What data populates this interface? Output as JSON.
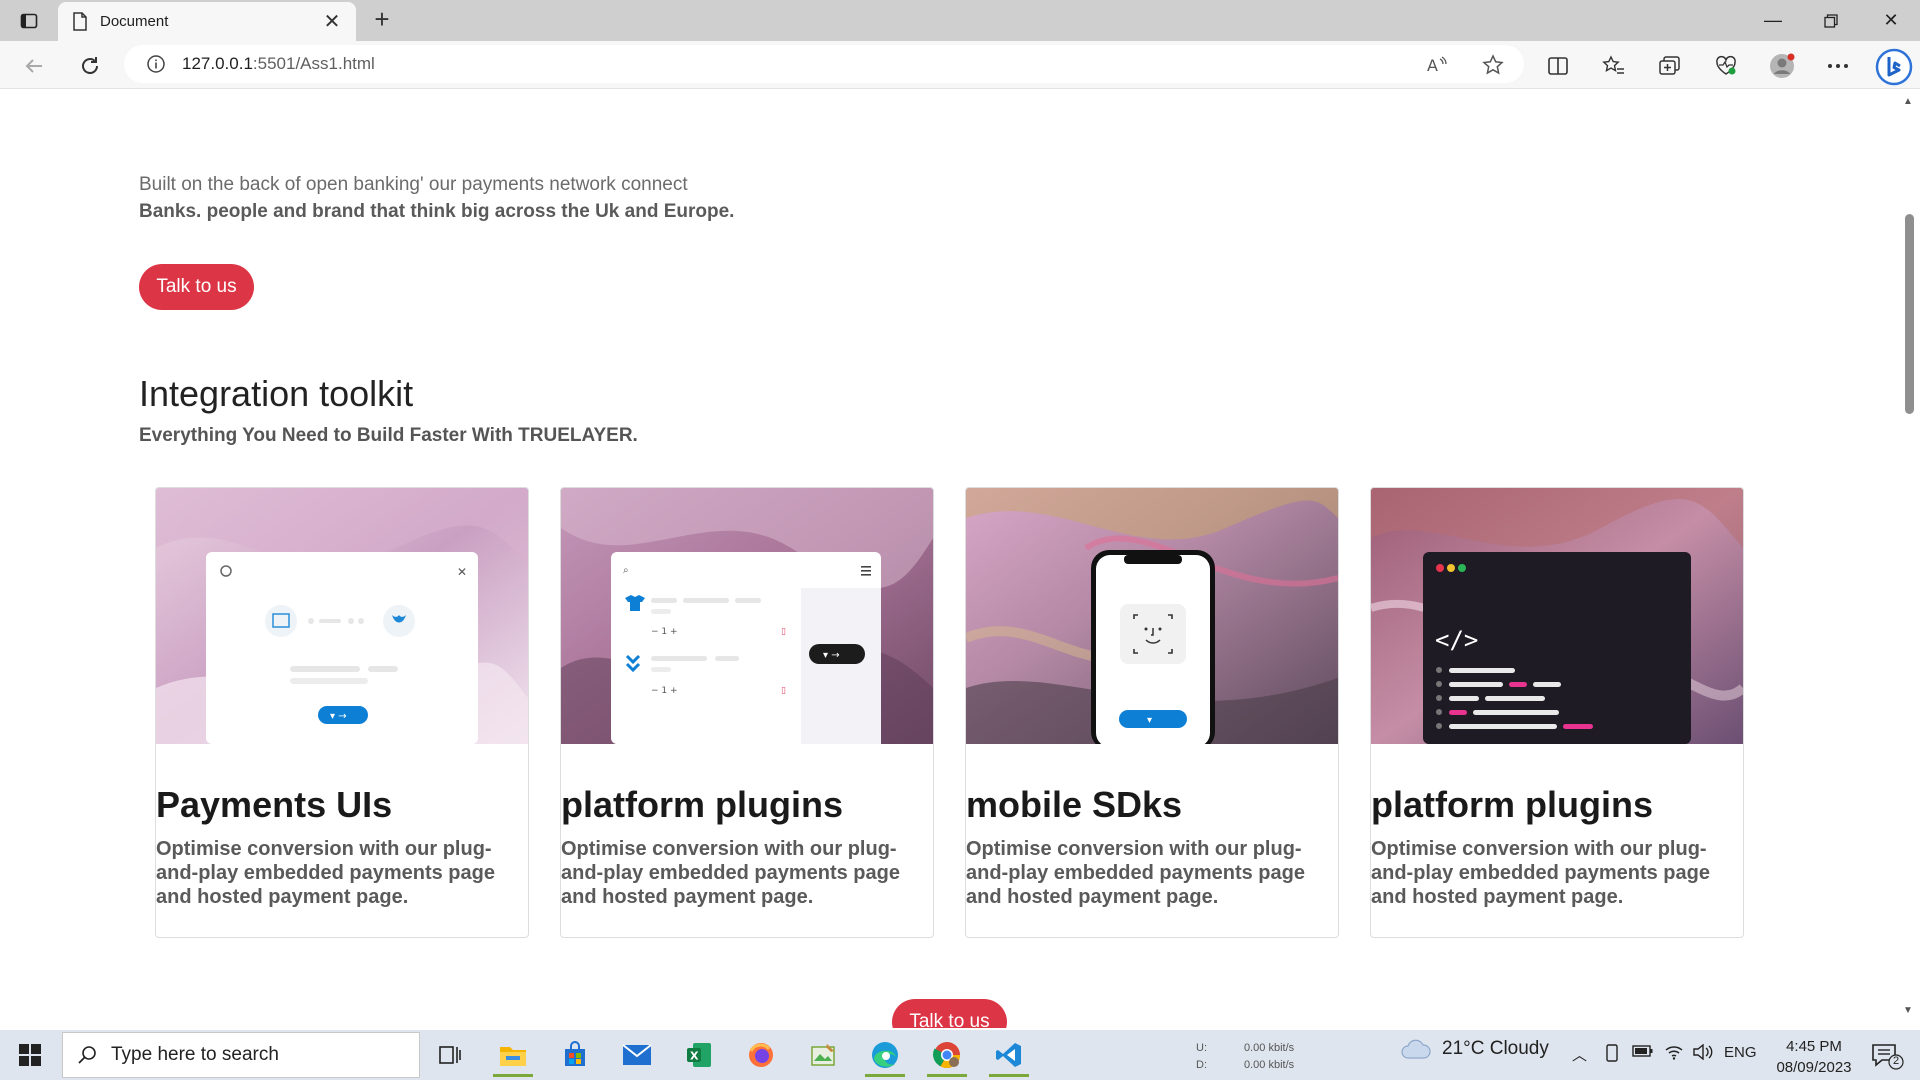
{
  "browser": {
    "tab_title": "Document",
    "url_host": "127.0.0.1",
    "url_rest": ":5501/Ass1.html"
  },
  "page": {
    "intro_line1": "Built on the back of open banking' our payments network connect",
    "intro_line2": "Banks. people and brand that think big across the Uk and Europe.",
    "cta_label": "Talk to us",
    "section_title": "Integration toolkit",
    "section_subtitle": "Everything You Need to Build Faster With TRUELAYER.",
    "cards": [
      {
        "title": "Payments UIs",
        "text": "Optimise conversion with our plug-and-play embedded payments page and hosted payment page."
      },
      {
        "title": "platform plugins",
        "text": "Optimise conversion with our plug-and-play embedded payments page and hosted payment page."
      },
      {
        "title": "mobile SDks",
        "text": "Optimise conversion with our plug-and-play embedded payments page and hosted payment page."
      },
      {
        "title": "platform plugins",
        "text": "Optimise conversion with our plug-and-play embedded payments page and hosted payment page."
      }
    ],
    "cta_bottom_label": "Talk to us"
  },
  "taskbar": {
    "search_placeholder": "Type here to search",
    "net_up_label": "U:",
    "net_down_label": "D:",
    "net_up": "0.00 kbit/s",
    "net_down": "0.00 kbit/s",
    "weather": "21°C  Cloudy",
    "lang": "ENG",
    "time": "4:45 PM",
    "date": "08/09/2023",
    "notif_count": "2"
  },
  "colors": {
    "accent": "#dc3545",
    "tabstrip": "#cfcfcf",
    "taskbar": "#dfe5ee"
  }
}
